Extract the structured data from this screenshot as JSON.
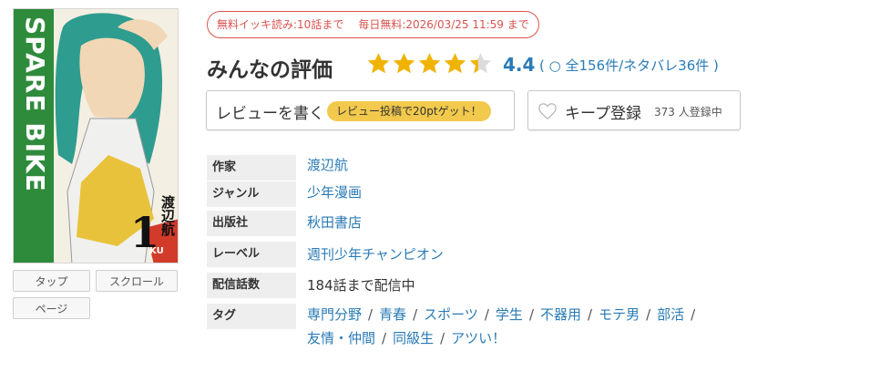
{
  "cover": {
    "title_text": "SPARE BIKE",
    "volume": "1",
    "author": "渡辺航",
    "colors": {
      "band": "#2f8b3c",
      "hair": "#2e9c8f"
    }
  },
  "view_modes": [
    "タップ",
    "スクロール",
    "ページ"
  ],
  "free_info": {
    "ikki": "無料イッキ読み:10話まで",
    "daily": "毎日無料:2026/03/25 11:59 まで"
  },
  "rating": {
    "title": "みんなの評価",
    "score": "4.4",
    "score_value": 4.4,
    "max_stars": 5,
    "count_text": "( ○ 全156件/ネタバレ36件 )"
  },
  "review_button": {
    "label": "レビューを書く",
    "promo": "レビュー投稿で20ptゲット！"
  },
  "keep_button": {
    "label": "キープ登録",
    "count": "373 人登録中"
  },
  "info": {
    "author_label": "作家",
    "author": "渡辺航",
    "genre_label": "ジャンル",
    "genre": "少年漫画",
    "publisher_label": "出版社",
    "publisher": "秋田書店",
    "label_label": "レーベル",
    "label": "週刊少年チャンピオン",
    "episodes_label": "配信話数",
    "episodes": "184話まで配信中",
    "tags_label": "タグ"
  },
  "tags_line1": [
    "専門分野",
    "青春",
    "スポーツ",
    "学生",
    "不器用",
    "モテ男",
    "部活"
  ],
  "tags_line2": [
    "友情・仲間",
    "同級生",
    "アツい！"
  ],
  "colors": {
    "accent": "#2a7bb6",
    "star": "#f0b400",
    "promo": "#f2c94c",
    "badge": "#d9534f"
  }
}
